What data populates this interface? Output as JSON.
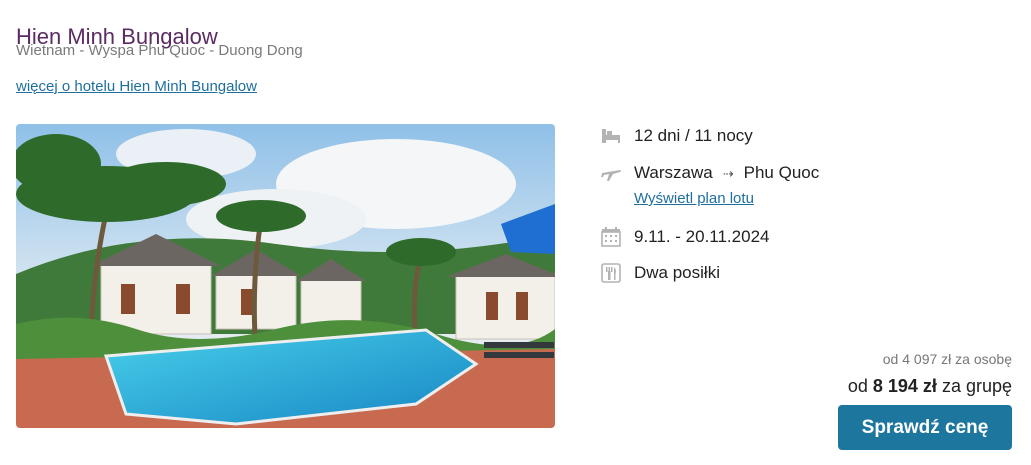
{
  "hotel": {
    "name": "Hien Minh Bungalow",
    "location": "Wietnam - Wyspa Phu Quoc - Duong Dong",
    "more_link": "więcej o hotelu Hien Minh Bungalow"
  },
  "details": {
    "duration": "12 dni / 11 nocy",
    "departure": "Warszawa",
    "arrow": "⇢",
    "destination": "Phu Quoc",
    "flight_plan_link": "Wyświetl plan lotu",
    "dates": "9.11. - 20.11.2024",
    "board": "Dwa posiłki",
    "icons": [
      "bed-icon",
      "airplane-icon",
      "calendar-icon",
      "cutlery-icon"
    ]
  },
  "price": {
    "per_person_prefix": "od",
    "per_person_amount": "4 097 zł",
    "per_person_suffix": "za osobę",
    "group_prefix": "od",
    "group_amount": "8 194 zł",
    "group_suffix": "za grupę",
    "button": "Sprawdź cenę"
  },
  "colors": {
    "title": "#5b2b63",
    "link": "#1f6f9e",
    "button": "#1d769e",
    "icon": "#b3b3b3"
  }
}
